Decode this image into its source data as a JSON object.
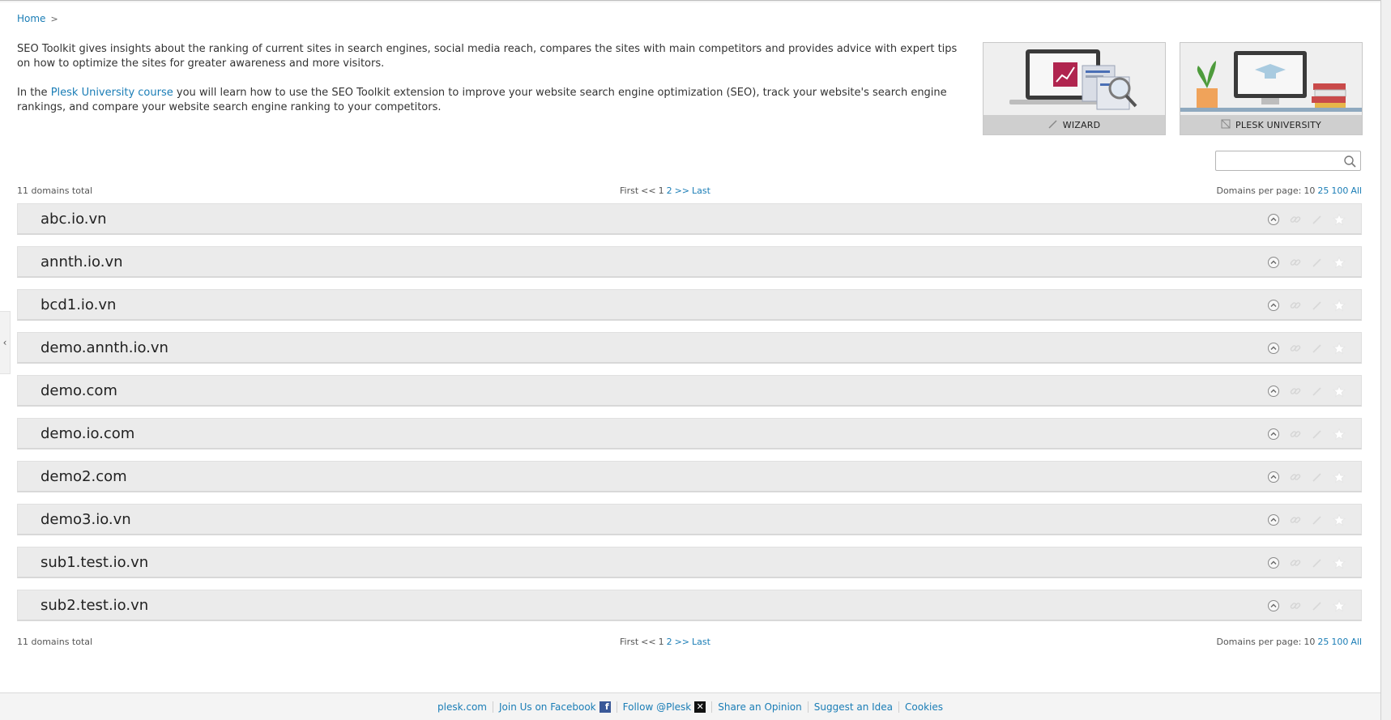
{
  "breadcrumb": {
    "home": "Home"
  },
  "intro": {
    "paragraph1": "SEO Toolkit gives insights about the ranking of current sites in search engines, social media reach, compares the sites with main competitors and provides advice with expert tips on how to optimize the sites for greater awareness and more visitors.",
    "p2_before": "In the ",
    "p2_link": "Plesk University course",
    "p2_after": " you will learn how to use the SEO Toolkit extension to improve your website search engine optimization (SEO), track your website's search engine rankings, and compare your website search engine ranking to your competitors."
  },
  "promos": {
    "wizard": "WIZARD",
    "university": "PLESK UNIVERSITY"
  },
  "search": {
    "value": ""
  },
  "pager": {
    "total": "11 domains total",
    "first": "First",
    "prev": "<<",
    "page1": "1",
    "page2": "2",
    "next": ">>",
    "last": "Last",
    "per_page_label": "Domains per page:",
    "per_10": "10",
    "per_25": "25",
    "per_100": "100",
    "per_all": "All"
  },
  "domains": [
    "abc.io.vn",
    "annth.io.vn",
    "bcd1.io.vn",
    "demo.annth.io.vn",
    "demo.com",
    "demo.io.com",
    "demo2.com",
    "demo3.io.vn",
    "sub1.test.io.vn",
    "sub2.test.io.vn"
  ],
  "row_icons": [
    "expand-up-icon",
    "link-icon",
    "edit-icon",
    "star-icon"
  ],
  "footer": {
    "plesk": "plesk.com",
    "facebook": "Join Us on Facebook",
    "follow": "Follow @Plesk",
    "opinion": "Share an Opinion",
    "idea": "Suggest an Idea",
    "cookies": "Cookies"
  },
  "colors": {
    "link": "#1a7db6",
    "row_bg": "#ebebeb",
    "footer_bg": "#f4f4f4"
  }
}
